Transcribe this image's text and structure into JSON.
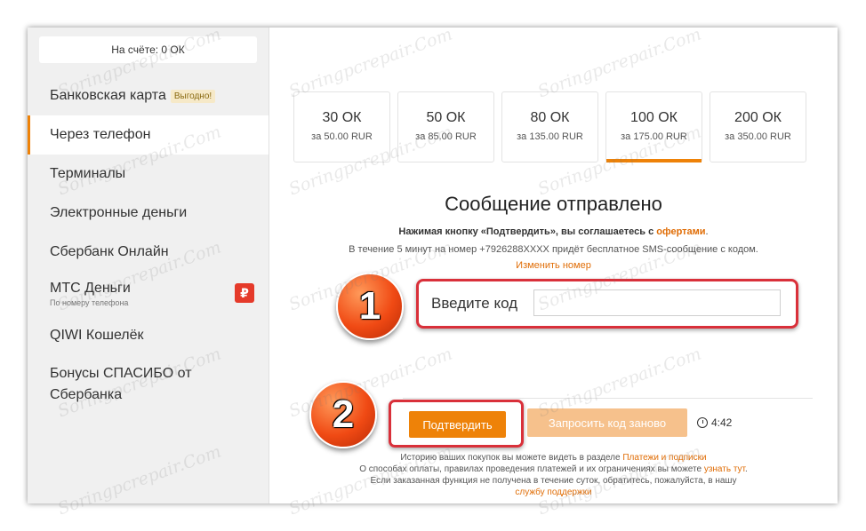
{
  "balance": "На счёте: 0 ОК",
  "sidebar": {
    "items": [
      {
        "label": "Банковская карта",
        "badge": "Выгодно!"
      },
      {
        "label": "Через телефон"
      },
      {
        "label": "Терминалы"
      },
      {
        "label": "Электронные деньги"
      },
      {
        "label": "Сбербанк Онлайн"
      },
      {
        "label": "МТС Деньги",
        "sublabel": "По номеру телефона"
      },
      {
        "label": "QIWI Кошелёк"
      },
      {
        "label": "Бонусы СПАСИБО от Сбербанка"
      }
    ],
    "active_index": 1
  },
  "packages": [
    {
      "amount": "30 ОК",
      "price": "за 50.00 RUR"
    },
    {
      "amount": "50 ОК",
      "price": "за 85.00 RUR"
    },
    {
      "amount": "80 ОК",
      "price": "за 135.00 RUR"
    },
    {
      "amount": "100 ОК",
      "price": "за 175.00 RUR"
    },
    {
      "amount": "200 ОК",
      "price": "за 350.00 RUR"
    }
  ],
  "selected_package_index": 3,
  "main": {
    "heading": "Сообщение отправлено",
    "agree_text": "Нажимая кнопку «Подтвердить», вы соглашаетесь с",
    "agree_link": "офертами",
    "info": "В течение 5 минут на номер +7926288XXXX придёт бесплатное SMS-сообщение с кодом.",
    "change_number": "Изменить номер",
    "code_label": "Введите код",
    "code_value": "",
    "confirm_label": "Подтвердить",
    "resend_label": "Запросить код заново",
    "timer": "4:42"
  },
  "steps": [
    "1",
    "2"
  ],
  "footer": {
    "line1_text": "Историю ваших покупок вы можете видеть в разделе",
    "line1_link": "Платежи и подписки",
    "line2_text": "О способах оплаты, правилах проведения платежей и их ограничениях вы можете",
    "line2_link": "узнать тут",
    "line3_text": "Если заказанная функция не получена в течение суток, обратитесь, пожалуйста, в нашу",
    "line3_link": "службу поддержки"
  },
  "watermark": "Soringpcrepair.Com",
  "colors": {
    "accent": "#ee8208",
    "highlight": "#d9303a",
    "sidebar_bg": "#f0f0f0"
  },
  "icons": {
    "mts": "mts-dengi-icon",
    "timer": "clock-icon"
  }
}
